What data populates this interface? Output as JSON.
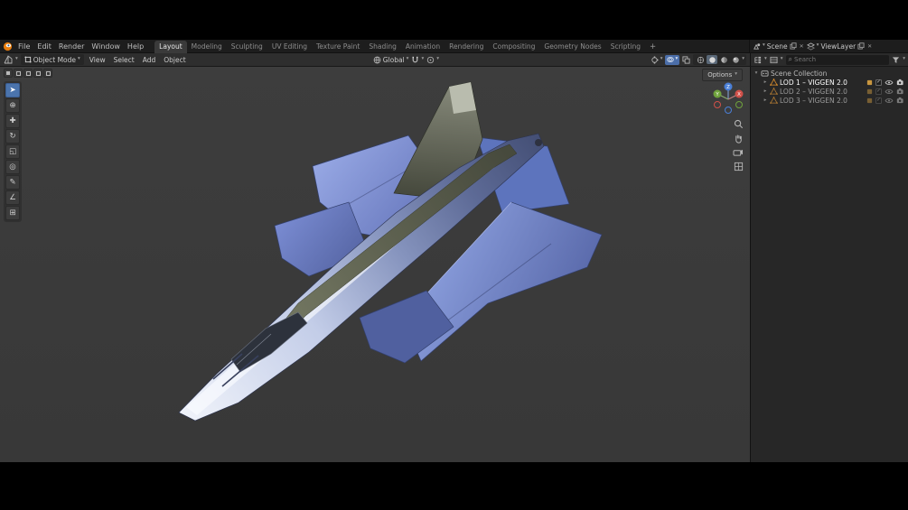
{
  "icons": {
    "chevron_down": "▾",
    "tri_right": "▸",
    "tri_down": "▾",
    "close": "✕",
    "check": "✓",
    "search": "⌕"
  },
  "topbar": {
    "menus": [
      {
        "label": "File"
      },
      {
        "label": "Edit"
      },
      {
        "label": "Render"
      },
      {
        "label": "Window"
      },
      {
        "label": "Help"
      }
    ],
    "tabs": [
      {
        "label": "Layout"
      },
      {
        "label": "Modeling"
      },
      {
        "label": "Sculpting"
      },
      {
        "label": "UV Editing"
      },
      {
        "label": "Texture Paint"
      },
      {
        "label": "Shading"
      },
      {
        "label": "Animation"
      },
      {
        "label": "Rendering"
      },
      {
        "label": "Compositing"
      },
      {
        "label": "Geometry Nodes"
      },
      {
        "label": "Scripting"
      }
    ],
    "new_workspace_label": "+",
    "scene_selector": {
      "label": "Scene"
    },
    "viewlayer_selector": {
      "label": "ViewLayer"
    }
  },
  "viewport_header": {
    "mode": "Object Mode",
    "menus": [
      {
        "label": "View"
      },
      {
        "label": "Select"
      },
      {
        "label": "Add"
      },
      {
        "label": "Object"
      }
    ],
    "orientation_label": "Global"
  },
  "viewport": {
    "options_label": "Options",
    "tools": [
      {
        "name": "select-box",
        "glyph": "➤"
      },
      {
        "name": "cursor",
        "glyph": "⊕"
      },
      {
        "name": "move",
        "glyph": "✚"
      },
      {
        "name": "rotate",
        "glyph": "↻"
      },
      {
        "name": "scale",
        "glyph": "◱"
      },
      {
        "name": "transform",
        "glyph": "◎"
      },
      {
        "name": "annotate",
        "glyph": "✎"
      },
      {
        "name": "measure",
        "glyph": "∠"
      },
      {
        "name": "add-cube",
        "glyph": "⊞"
      }
    ],
    "gizmo_axes": {
      "x": "X",
      "y": "Y",
      "z": "Z"
    }
  },
  "outliner": {
    "search_placeholder": "Search",
    "rows": [
      {
        "label": "Scene Collection"
      },
      {
        "label": "LOD 1 – VIGGEN 2.0"
      },
      {
        "label": "LOD 2 – VIGGEN 2.0"
      },
      {
        "label": "LOD 3 – VIGGEN 2.0"
      }
    ]
  },
  "colors": {
    "accent": "#4b74ad",
    "object_orange": "#e0902c",
    "wing_blue": "#6d85cf"
  }
}
